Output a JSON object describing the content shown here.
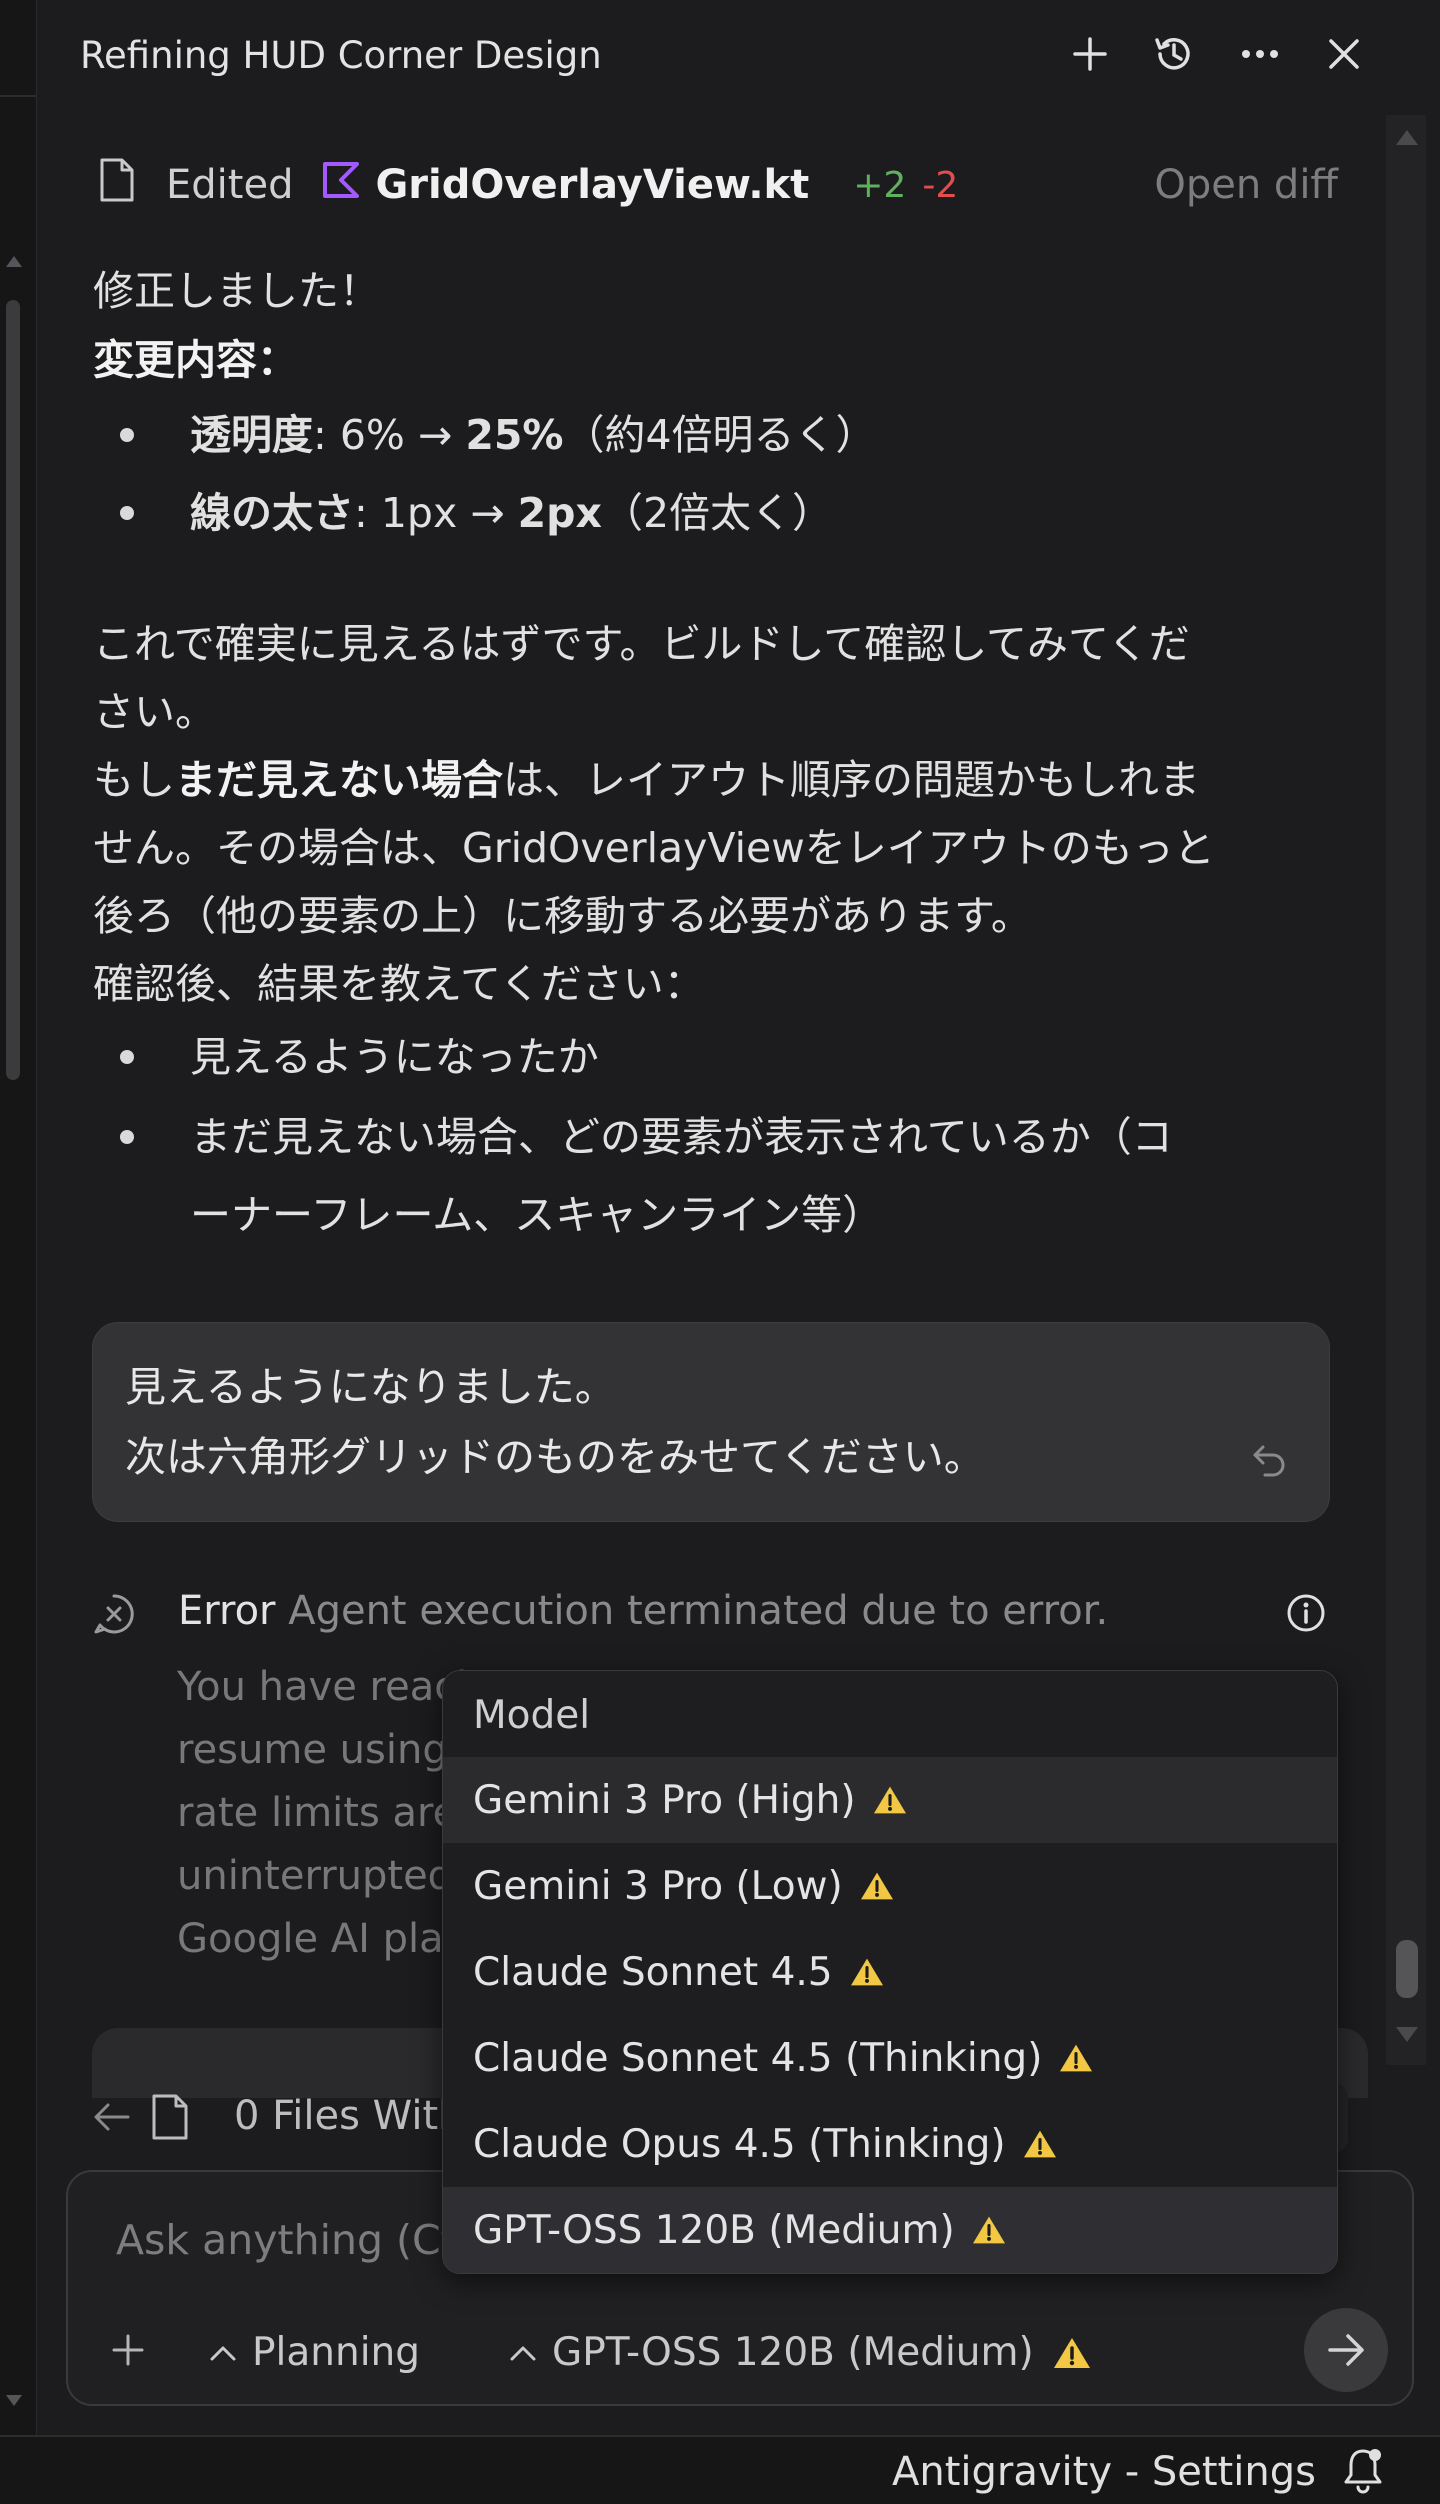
{
  "header": {
    "title": "Refining HUD Corner Design"
  },
  "edit_row": {
    "label": "Edited",
    "filename": "GridOverlayView.kt",
    "added": "+2",
    "removed": "-2",
    "open_diff": "Open diff"
  },
  "assistant_message": {
    "line1": "修正しました！",
    "line2": "変更内容：",
    "bullets": [
      {
        "bold": "透明度",
        "text": ": 6% → ",
        "bold2": "25%",
        "rest": "（約4倍明るく）"
      },
      {
        "bold": "線の太さ",
        "text": ": 1px → ",
        "bold2": "2px",
        "rest": "（2倍太く）"
      }
    ],
    "para1_line1": "これで確実に見えるはずです。ビルドして確認してみてくだ",
    "para1_line2": "さい。",
    "para2_prefix": "もし",
    "para2_bold": "まだ見えない場合",
    "para2_suffix": "は、レイアウト順序の問題かもしれま",
    "para2_line2": "せん。その場合は、GridOverlayViewをレイアウトのもっと",
    "para2_line3": "後ろ（他の要素の上）に移動する必要があります。",
    "para3": "確認後、結果を教えてください：",
    "check_bullets": [
      "見えるようになったか",
      "まだ見えない場合、どの要素が表示されているか（コ",
      "ーナーフレーム、スキャンライン等）"
    ]
  },
  "user_message": {
    "line1": "見えるようになりました。",
    "line2": "次は六角形グリッドのものをみせてください。"
  },
  "error": {
    "label": "Error",
    "message": "Agent execution terminated due to error.",
    "body_lines": [
      "You have reach",
      "resume using",
      "rate limits are",
      "uninterrupted",
      "Google AI plar"
    ]
  },
  "files_bar": {
    "text": "0 Files With"
  },
  "input": {
    "placeholder": "Ask anything (Ctrl",
    "mode": "Planning",
    "model": "GPT-OSS 120B (Medium)"
  },
  "model_menu": {
    "header": "Model",
    "items": [
      {
        "label": "Gemini 3 Pro (High)",
        "warning": true
      },
      {
        "label": "Gemini 3 Pro (Low)",
        "warning": true
      },
      {
        "label": "Claude Sonnet 4.5",
        "warning": true
      },
      {
        "label": "Claude Sonnet 4.5 (Thinking)",
        "warning": true
      },
      {
        "label": "Claude Opus 4.5 (Thinking)",
        "warning": true
      },
      {
        "label": "GPT-OSS 120B (Medium)",
        "warning": true
      }
    ]
  },
  "status_bar": {
    "text": "Antigravity - Settings"
  },
  "colors": {
    "added": "#5fb15f",
    "removed": "#e34d4d",
    "warning": "#f2c744",
    "kotlin": "#a259ff"
  }
}
